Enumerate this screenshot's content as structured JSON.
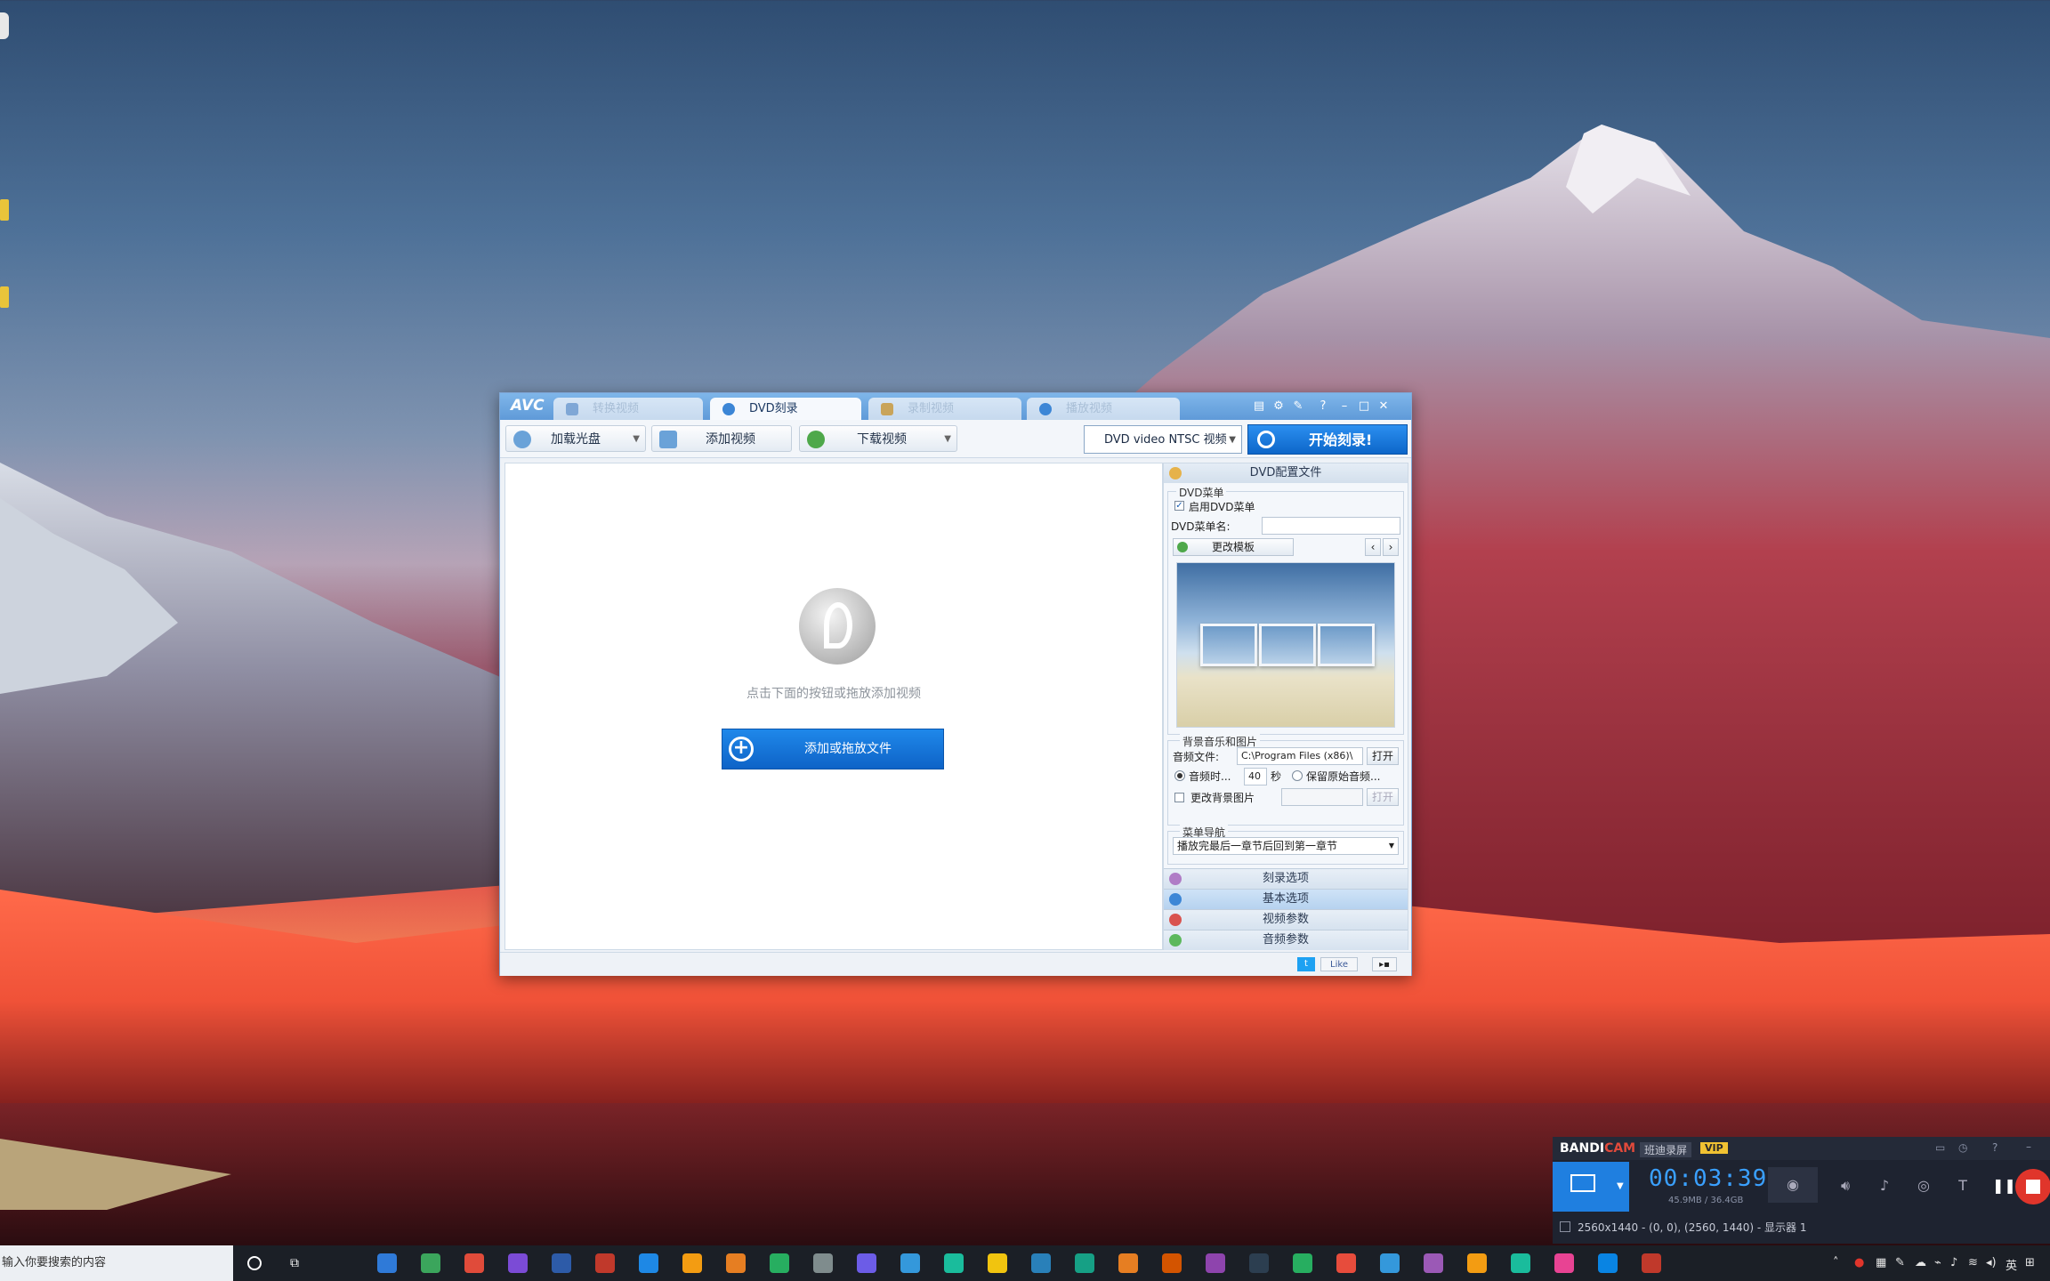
{
  "avc": {
    "logo": "AVC",
    "tabs": [
      {
        "label": "转换视频",
        "active": false
      },
      {
        "label": "DVD刻录",
        "active": true
      },
      {
        "label": "录制视频",
        "active": false
      },
      {
        "label": "播放视频",
        "active": false
      }
    ],
    "toolbar": {
      "load_disc": "加载光盘",
      "add_video": "添加视频",
      "download_video": "下载视频",
      "profile": "DVD video NTSC 视频",
      "start": "开始刻录!"
    },
    "main": {
      "hint": "点击下面的按钮或拖放添加视频",
      "add_button": "添加或拖放文件"
    },
    "side": {
      "header": "DVD配置文件",
      "menu_group": "DVD菜单",
      "enable_menu": "启用DVD菜单",
      "enable_menu_checked": true,
      "menu_name_label": "DVD菜单名:",
      "menu_name_value": "",
      "change_template": "更改模板",
      "bg_group": "背景音乐和图片",
      "audio_file_label": "音频文件:",
      "audio_file_value": "C:\\Program Files (x86)\\",
      "open": "打开",
      "audio_duration_label": "音频时...",
      "audio_duration_value": "40",
      "seconds": "秒",
      "keep_audio": "保留原始音频...",
      "change_bg": "更改背景图片",
      "change_bg_open": "打开",
      "nav_group": "菜单导航",
      "nav_value": "播放完最后一章节后回到第一章节",
      "sections": [
        {
          "label": "刻录选项",
          "color": "#b07cc6"
        },
        {
          "label": "基本选项",
          "color": "#3c86d6"
        },
        {
          "label": "视频参数",
          "color": "#d9534f"
        },
        {
          "label": "音频参数",
          "color": "#5cb85c"
        }
      ]
    },
    "status": {
      "like": "Like"
    }
  },
  "bandicam": {
    "brand_a": "BANDI",
    "brand_b": "CAM",
    "sub": "班迪录屏",
    "vip": "VIP",
    "timer": "00:03:39",
    "size": "45.9MB / 36.4GB",
    "resolution": "2560x1440 - (0, 0), (2560, 1440) - 显示器 1"
  },
  "taskbar": {
    "search_placeholder": "输入你要搜索的内容",
    "lang": "英",
    "apps": [
      "#2f7ad8",
      "#3ba55c",
      "#e04b3a",
      "#7b4bd6",
      "#2d5ba8",
      "#c0392b",
      "#1e88e5",
      "#f39c12",
      "#e67e22",
      "#27ae60",
      "#7f8c8d",
      "#6c5ce7",
      "#3498db",
      "#1abc9c",
      "#f1c40f",
      "#2980b9",
      "#16a085",
      "#e67e22",
      "#d35400",
      "#8e44ad",
      "#2c3e50",
      "#27ae60",
      "#e74c3c",
      "#3498db",
      "#9b59b6",
      "#f39c12",
      "#1abc9c",
      "#e84393",
      "#0984e3",
      "#c0392b"
    ]
  }
}
